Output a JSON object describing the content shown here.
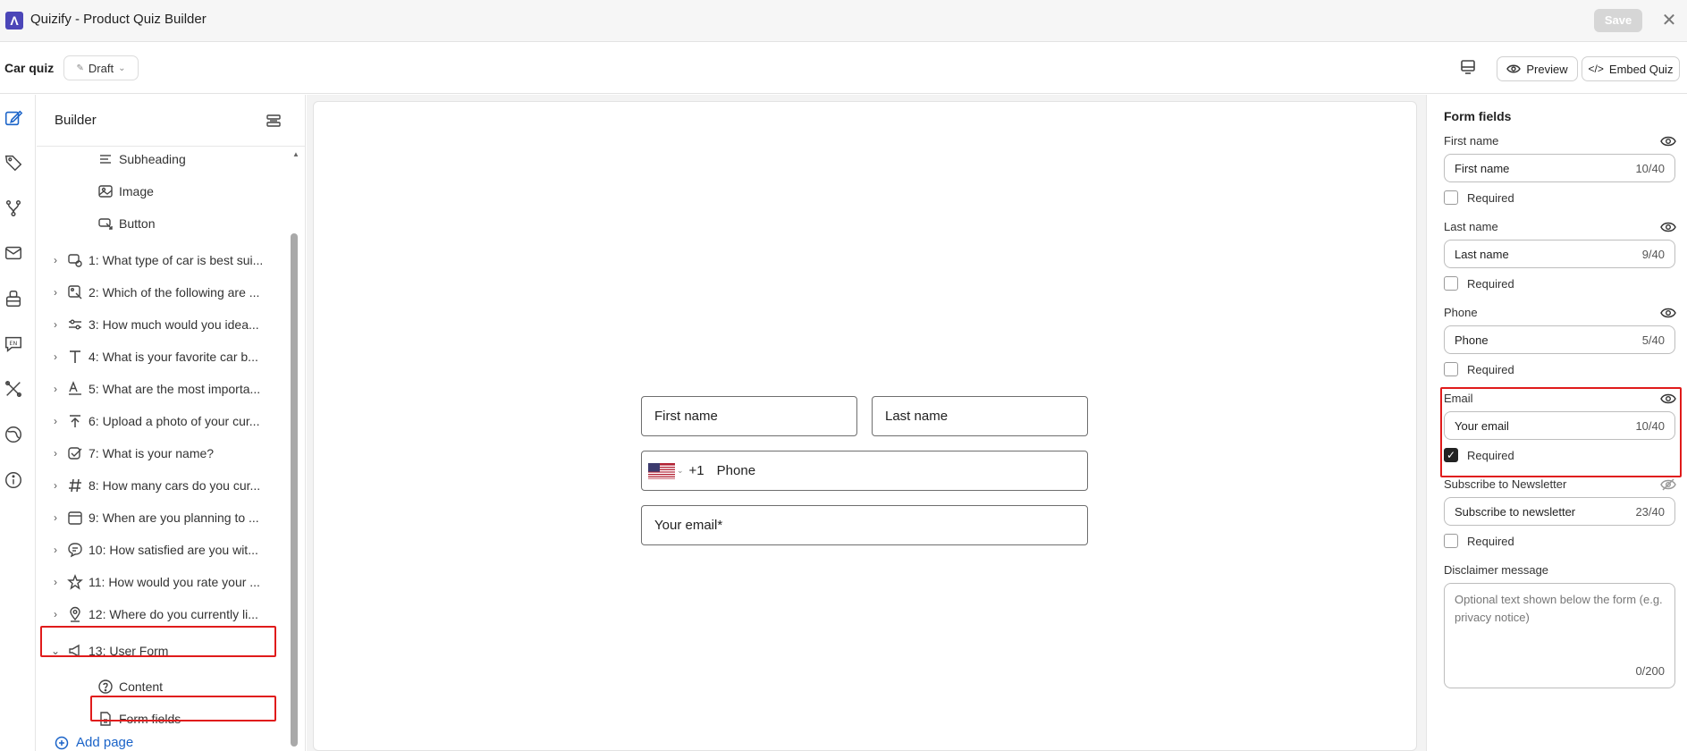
{
  "app": {
    "logo": "Λ",
    "title": "Quizify - Product Quiz Builder",
    "save_label": "Save",
    "close_label": "✕"
  },
  "topbar": {
    "quiz_name": "Car quiz",
    "status": "Draft",
    "preview_label": "Preview",
    "embed_label": "Embed Quiz"
  },
  "rail": {
    "icons": [
      "edit-icon",
      "tag-icon",
      "branch-icon",
      "mail-icon",
      "integrations-icon",
      "translate-icon",
      "design-tools-icon",
      "globe-icon",
      "info-icon"
    ]
  },
  "builder": {
    "title": "Builder",
    "sub_items": [
      {
        "icon": "subheading-icon",
        "label": "Subheading"
      },
      {
        "icon": "image-icon",
        "label": "Image"
      },
      {
        "icon": "button-icon",
        "label": "Button"
      }
    ],
    "pages": [
      {
        "icon": "car-icon",
        "label": "1: What type of car is best sui..."
      },
      {
        "icon": "image-choice-icon",
        "label": "2: Which of the following are ..."
      },
      {
        "icon": "slider-icon",
        "label": "3: How much would you idea..."
      },
      {
        "icon": "text-icon",
        "label": "4: What is your favorite car b..."
      },
      {
        "icon": "text-format-icon",
        "label": "5: What are the most importa..."
      },
      {
        "icon": "upload-icon",
        "label": "6: Upload a photo of your cur..."
      },
      {
        "icon": "checkbox-edit-icon",
        "label": "7: What is your name?"
      },
      {
        "icon": "hash-icon",
        "label": "8: How many cars do you cur..."
      },
      {
        "icon": "calendar-icon",
        "label": "9: When are you planning to ..."
      },
      {
        "icon": "comment-icon",
        "label": "10: How satisfied are you wit..."
      },
      {
        "icon": "star-icon",
        "label": "11: How would you rate your ..."
      },
      {
        "icon": "location-icon",
        "label": "12: Where do you currently li..."
      },
      {
        "icon": "megaphone-icon",
        "label": "13: User Form"
      }
    ],
    "form_children": [
      {
        "icon": "question-icon",
        "label": "Content"
      },
      {
        "icon": "document-icon",
        "label": "Form fields"
      }
    ],
    "add_page_label": "Add page"
  },
  "preview_form": {
    "first_name": "First name",
    "last_name": "Last name",
    "country_code": "+1",
    "phone": "Phone",
    "email": "Your email*"
  },
  "panel": {
    "title": "Form fields",
    "required_label": "Required",
    "fields": [
      {
        "label": "First name",
        "value": "First name",
        "count": "10/40",
        "required": false,
        "visible": true
      },
      {
        "label": "Last name",
        "value": "Last name",
        "count": "9/40",
        "required": false,
        "visible": true
      },
      {
        "label": "Phone",
        "value": "Phone",
        "count": "5/40",
        "required": false,
        "visible": true
      },
      {
        "label": "Email",
        "value": "Your email",
        "count": "10/40",
        "required": true,
        "visible": true
      },
      {
        "label": "Subscribe to Newsletter",
        "value": "Subscribe to newsletter",
        "count": "23/40",
        "required": false,
        "visible": false
      }
    ],
    "disclaimer_label": "Disclaimer message",
    "disclaimer_placeholder": "Optional text shown below the form (e.g. privacy notice)",
    "disclaimer_count": "0/200"
  },
  "colors": {
    "accent": "#1a63c8",
    "highlight": "#e01b1b",
    "logo": "#4b46b8"
  }
}
